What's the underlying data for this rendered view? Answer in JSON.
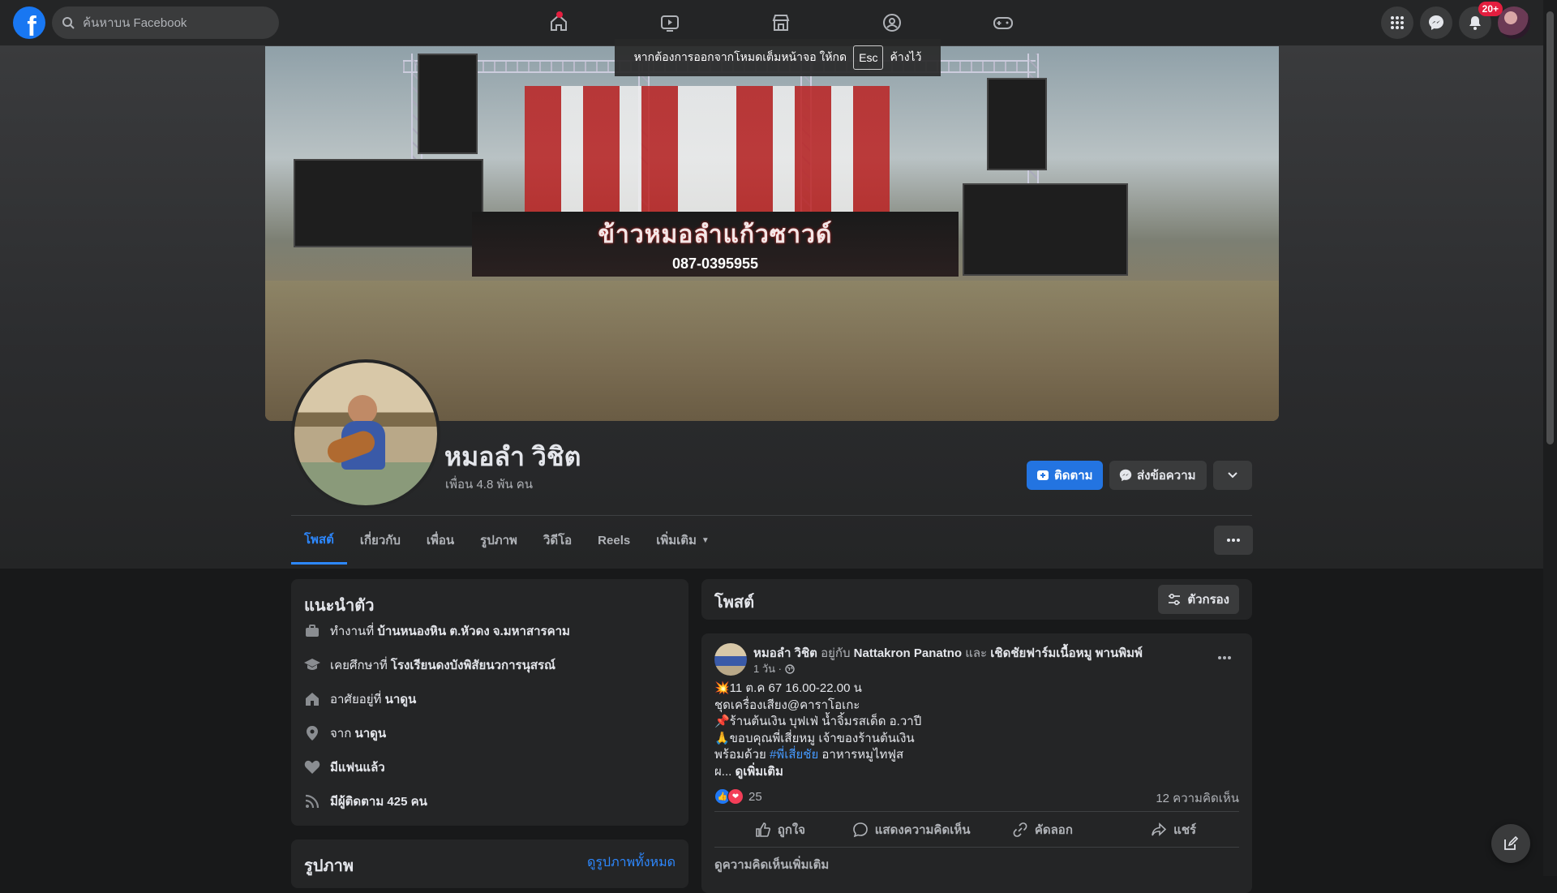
{
  "topbar": {
    "logo_letter": "f",
    "search_placeholder": "ค้นหาบน Facebook",
    "nav_icons": [
      "home-icon",
      "watch-icon",
      "marketplace-icon",
      "groups-icon",
      "gaming-icon"
    ],
    "notification_count": "20+"
  },
  "fullscreen_hint": {
    "before": "หากต้องการออกจากโหมดเต็มหน้าจอ ให้กด",
    "key": "Esc",
    "after": "ค้างไว้"
  },
  "cover": {
    "banner_title": "ข้าวหมอลำแก้วซาวด์",
    "banner_phone": "087-0395955"
  },
  "profile": {
    "name": "หมอลำ วิชิต",
    "friends": "เพื่อน 4.8 พัน คน",
    "follow_label": "ติดตาม",
    "message_label": "ส่งข้อความ"
  },
  "tabs": [
    {
      "label": "โพสต์",
      "active": true
    },
    {
      "label": "เกี่ยวกับ"
    },
    {
      "label": "เพื่อน"
    },
    {
      "label": "รูปภาพ"
    },
    {
      "label": "วิดีโอ"
    },
    {
      "label": "Reels"
    },
    {
      "label": "เพิ่มเติม"
    }
  ],
  "intro": {
    "title": "แนะนำตัว",
    "items": [
      {
        "icon": "briefcase-icon",
        "prefix": "ทำงานที่ ",
        "value": "บ้านหนองหิน ต.หัวดง จ.มหาสารคาม"
      },
      {
        "icon": "graduation-cap-icon",
        "prefix": "เคยศึกษาที่ ",
        "value": "โรงเรียนดงบังพิสัยนวการนุสรณ์"
      },
      {
        "icon": "home-icon",
        "prefix": "อาศัยอยู่ที่ ",
        "value": "นาดูน"
      },
      {
        "icon": "location-pin-icon",
        "prefix": "จาก ",
        "value": "นาดูน"
      },
      {
        "icon": "heart-icon",
        "prefix": "",
        "value": "มีแฟนแล้ว"
      },
      {
        "icon": "rss-icon",
        "prefix": "",
        "value": "มีผู้ติดตาม 425 คน"
      }
    ]
  },
  "photos_card": {
    "title": "รูปภาพ",
    "see_all": "ดูรูปภาพทั้งหมด"
  },
  "posts_header": {
    "title": "โพสต์",
    "filter_label": "ตัวกรอง"
  },
  "post": {
    "author": "หมอลำ วิชิต",
    "with_text": " อยู่กับ ",
    "tagged_1": "Nattakron Panatno",
    "and_text": " และ ",
    "tagged_2": "เชิดชัยฟาร์มเนื้อหมู พานพิมพ์",
    "time": "1 วัน ·",
    "lines": [
      "💥11 ต.ค 67  16.00-22.00 น",
      "ชุดเครื่องเสียง@คาราโอเกะ",
      "📌ร้านต้นเงิน บุฟเฟ่ น้ำจิ้มรสเด็ด อ.วาปี",
      "🙏ขอบคุณพี่เสี่ยหมู เจ้าของร้านต้นเงิน"
    ],
    "line5_prefix": "พร้อมด้วย ",
    "hashtag": "#พี่เสี่ยชัย",
    "line5_suffix": " อาหารหมูไทฟูส",
    "line6_prefix": " ผ... ",
    "see_more": "ดูเพิ่มเติม",
    "reaction_count": "25",
    "comment_count": "12 ความคิดเห็น",
    "like_label": "ถูกใจ",
    "comment_label": "แสดงความคิดเห็น",
    "copy_label": "คัดลอก",
    "share_label": "แชร์",
    "more_comments": "ดูความคิดเห็นเพิ่มเติม"
  },
  "colors": {
    "accent": "#2374e1",
    "background": "#18191a",
    "card": "#242526"
  }
}
